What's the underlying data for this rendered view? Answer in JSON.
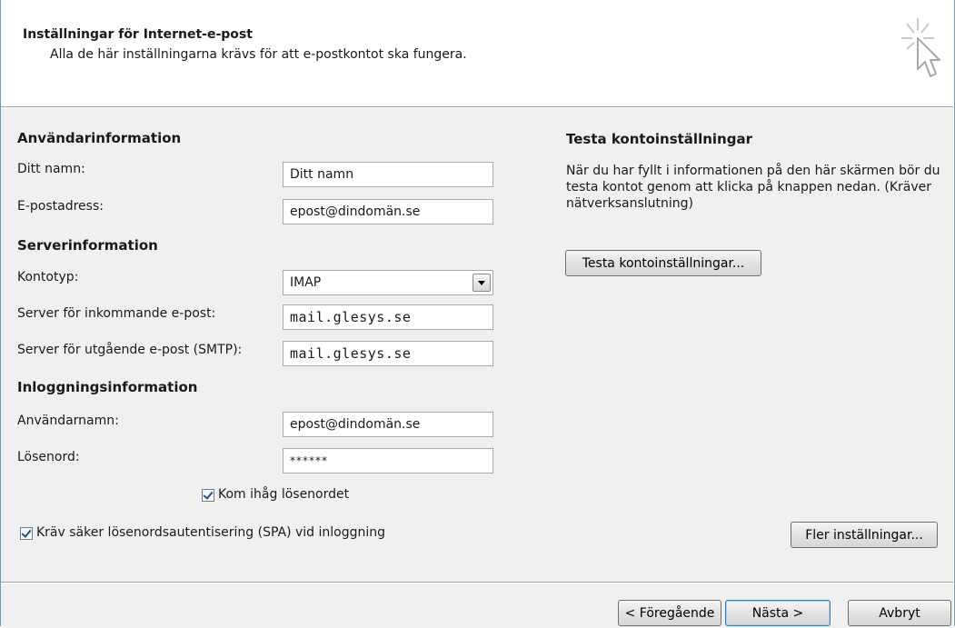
{
  "header": {
    "title": "Inställningar för Internet-e-post",
    "subtitle": "Alla de här inställningarna krävs för att e-postkontot ska fungera."
  },
  "user_info": {
    "heading": "Användarinformation",
    "name_label": "Ditt namn:",
    "name_value": "Ditt namn",
    "email_label": "E-postadress:",
    "email_value": "epost@dindomän.se"
  },
  "server_info": {
    "heading": "Serverinformation",
    "account_type_label": "Kontotyp:",
    "account_type_value": "IMAP",
    "incoming_label": "Server för inkommande e-post:",
    "incoming_value": "mail.glesys.se",
    "outgoing_label": "Server för utgående e-post (SMTP):",
    "outgoing_value": "mail.glesys.se"
  },
  "login_info": {
    "heading": "Inloggningsinformation",
    "username_label": "Användarnamn:",
    "username_value": "epost@dindomän.se",
    "password_label": "Lösenord:",
    "password_value": "******",
    "remember_label": "Kom ihåg lösenordet",
    "remember_checked": true
  },
  "spa": {
    "label": "Kräv säker lösenordsautentisering (SPA) vid inloggning",
    "checked": true
  },
  "test": {
    "heading": "Testa kontoinställningar",
    "description": "När du har fyllt i informationen på den här skärmen bör du testa kontot genom att klicka på knappen nedan. (Kräver nätverksanslutning)",
    "button_label": "Testa kontoinställningar..."
  },
  "more_settings_label": "Fler inställningar...",
  "footer": {
    "back_label": "< Föregående",
    "next_label": "Nästa >",
    "cancel_label": "Avbryt"
  },
  "icons": {
    "wizard": "wizard-cursor-icon",
    "dropdown": "chevron-down-icon",
    "checkbox": "checkmark-icon"
  }
}
